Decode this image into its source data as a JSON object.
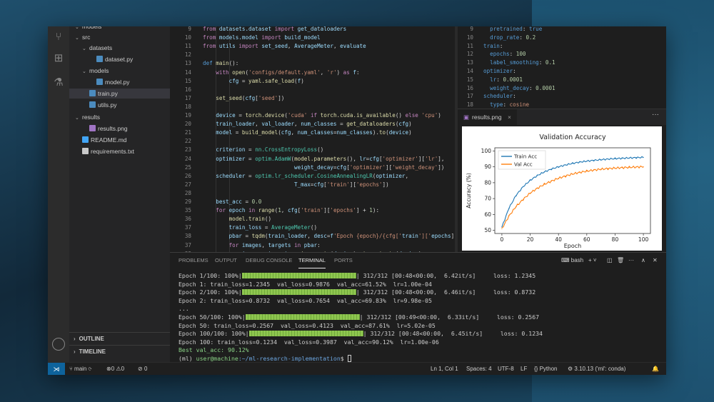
{
  "sidebar": {
    "items": [
      {
        "label": "models",
        "indent": 0,
        "kind": "folder",
        "open": true,
        "cut": true
      },
      {
        "label": "src",
        "indent": 0,
        "kind": "folder",
        "open": true
      },
      {
        "label": "datasets",
        "indent": 1,
        "kind": "folder",
        "open": true
      },
      {
        "label": "dataset.py",
        "indent": 2,
        "kind": "py"
      },
      {
        "label": "models",
        "indent": 1,
        "kind": "folder",
        "open": true
      },
      {
        "label": "model.py",
        "indent": 2,
        "kind": "py"
      },
      {
        "label": "train.py",
        "indent": 1,
        "kind": "py",
        "selected": true
      },
      {
        "label": "utils.py",
        "indent": 1,
        "kind": "py"
      },
      {
        "label": "results",
        "indent": 0,
        "kind": "folder",
        "open": true
      },
      {
        "label": "results.png",
        "indent": 1,
        "kind": "png"
      },
      {
        "label": "README.md",
        "indent": 0,
        "kind": "md"
      },
      {
        "label": "requirements.txt",
        "indent": 0,
        "kind": "txt"
      }
    ],
    "outline_label": "OUTLINE",
    "timeline_label": "TIMELINE"
  },
  "editor": {
    "lines": [
      {
        "n": "9",
        "code": "from datasets.dataset import get_dataloaders"
      },
      {
        "n": "10",
        "code": "from models.model import build_model"
      },
      {
        "n": "11",
        "code": "from utils import set_seed, AverageMeter, evaluate"
      },
      {
        "n": "12",
        "code": ""
      },
      {
        "n": "13",
        "code": "def main():"
      },
      {
        "n": "14",
        "code": "    with open('configs/default.yaml', 'r') as f:"
      },
      {
        "n": "15",
        "code": "        cfg = yaml.safe_load(f)"
      },
      {
        "n": "16",
        "code": ""
      },
      {
        "n": "17",
        "code": "    set_seed(cfg['seed'])"
      },
      {
        "n": "18",
        "code": ""
      },
      {
        "n": "19",
        "code": "    device = torch.device('cuda' if torch.cuda.is_available() else 'cpu')"
      },
      {
        "n": "20",
        "code": "    train_loader, val_loader, num_classes = get_dataloaders(cfg)"
      },
      {
        "n": "21",
        "code": "    model = build_model(cfg, num_classes=num_classes).to(device)"
      },
      {
        "n": "22",
        "code": ""
      },
      {
        "n": "23",
        "code": "    criterion = nn.CrossEntropyLoss()"
      },
      {
        "n": "24",
        "code": "    optimizer = optim.AdamW(model.parameters(), lr=cfg['optimizer']['lr'],"
      },
      {
        "n": "25",
        "code": "                            weight_decay=cfg['optimizer']['weight_decay'])"
      },
      {
        "n": "26",
        "code": "    scheduler = optim.lr_scheduler.CosineAnnealingLR(optimizer,"
      },
      {
        "n": "27",
        "code": "                            T_max=cfg['train']['epochs'])"
      },
      {
        "n": "28",
        "code": ""
      },
      {
        "n": "29",
        "code": "    best_acc = 0.0"
      },
      {
        "n": "35",
        "code": "    for epoch in range(1, cfg['train']['epochs'] + 1):"
      },
      {
        "n": "36",
        "code": "        model.train()"
      },
      {
        "n": "37",
        "code": "        train_loss = AverageMeter()"
      },
      {
        "n": "38",
        "code": "        pbar = tqdm(train_loader, desc=f'Epoch {epoch}/{cfg['train']['epochs']"
      },
      {
        "n": "37",
        "code": "        for images, targets in pbar:"
      },
      {
        "n": "33",
        "code": "            images, targets = images.to(device), targets.to(device)"
      },
      {
        "n": "",
        "code": "            ..."
      }
    ]
  },
  "config": {
    "lines": [
      {
        "n": "9",
        "code": "  pretrained: true"
      },
      {
        "n": "10",
        "code": "  drop_rate: 0.2"
      },
      {
        "n": "11",
        "code": "train:"
      },
      {
        "n": "12",
        "code": "  epochs: 100"
      },
      {
        "n": "13",
        "code": "  label_smoothing: 0.1"
      },
      {
        "n": "14",
        "code": "optimizer:"
      },
      {
        "n": "15",
        "code": "  lr: 0.0001"
      },
      {
        "n": "16",
        "code": "  weight_decay: 0.0001"
      },
      {
        "n": "17",
        "code": "scheduler:"
      },
      {
        "n": "18",
        "code": "  type: cosine"
      }
    ]
  },
  "image_tab": {
    "label": "results.png",
    "close": "×",
    "more": "···"
  },
  "chart_data": {
    "type": "line",
    "title": "Validation Accuracy",
    "xlabel": "Epoch",
    "ylabel": "Accuracy (%)",
    "xlim": [
      -5,
      105
    ],
    "ylim": [
      48,
      102
    ],
    "xticks": [
      0,
      20,
      40,
      60,
      80,
      100
    ],
    "yticks": [
      50,
      60,
      70,
      80,
      90,
      100
    ],
    "legend_position": "top-left",
    "x": [
      0,
      5,
      10,
      15,
      20,
      25,
      30,
      35,
      40,
      45,
      50,
      55,
      60,
      65,
      70,
      75,
      80,
      85,
      90,
      95,
      100
    ],
    "series": [
      {
        "name": "Train Acc",
        "color": "#1f77b4",
        "values": [
          52,
          64,
          72,
          77.5,
          81.5,
          84.5,
          86.8,
          88.6,
          90,
          91.2,
          92.2,
          93,
          93.6,
          94.1,
          94.5,
          94.9,
          95.2,
          95.4,
          95.6,
          95.8,
          96
        ]
      },
      {
        "name": "Val Acc",
        "color": "#ff7f0e",
        "values": [
          51,
          59,
          65,
          69.5,
          73.5,
          76.5,
          79,
          81,
          82.8,
          84.2,
          85.5,
          86.5,
          87.3,
          88,
          88.5,
          88.9,
          89.2,
          89.5,
          89.7,
          89.9,
          90.1
        ]
      }
    ]
  },
  "panel": {
    "tabs": [
      "PROBLEMS",
      "OUTPUT",
      "DEBUG CONSOLE",
      "TERMINAL",
      "PORTS"
    ],
    "active_tab": "TERMINAL",
    "shell": "bash",
    "terminal": {
      "l1a": "Epoch 1/100: 100%|",
      "l1b": "| 312/312 [00:48<00:00,  6.42it/s]     loss: 1.2345",
      "l2": "Epoch 1: train_loss=1.2345  val_loss=0.9876  val_acc=61.52%  lr=1.00e-04",
      "l3a": "Epoch 2/100: 100%|",
      "l3b": "| 312/312 [00:48<00:00,  6.46it/s]     loss: 0.8732",
      "l4": "Epoch 2: train_loss=0.8732  val_loss=0.7654  val_acc=69.83%  lr=9.98e-05",
      "l5": "...",
      "l6a": "Epoch 50/100: 100%|",
      "l6b": "| 312/312 [00:49<00:00,  6.33it/s]     loss: 0.2567",
      "l7": "Epoch 50: train_loss=0.2567  val_loss=0.4123  val_acc=87.61%  lr=5.02e-05",
      "l8a": "Epoch 100/100: 100%|",
      "l8b": "| 312/312 [00:48<00:00,  6.45it/s]     loss: 0.1234",
      "l9": "Epoch 100: train_loss=0.1234  val_loss=0.3987  val_acc=90.12%  lr=1.00e-06",
      "l10": "Best val_acc: 90.12%",
      "prompt_env": "(ml) ",
      "prompt_user": "user@machine",
      "prompt_path": ":~/ml-research-implementation",
      "prompt_sym": "$ "
    }
  },
  "status": {
    "branch": "main",
    "errors": "0",
    "warnings": "0",
    "ports": "0",
    "position": "Ln 1, Col 1",
    "spaces": "Spaces: 4",
    "encoding": "UTF-8",
    "eol": "LF",
    "language": "Python",
    "interpreter": "3.10.13 ('ml': conda)"
  }
}
